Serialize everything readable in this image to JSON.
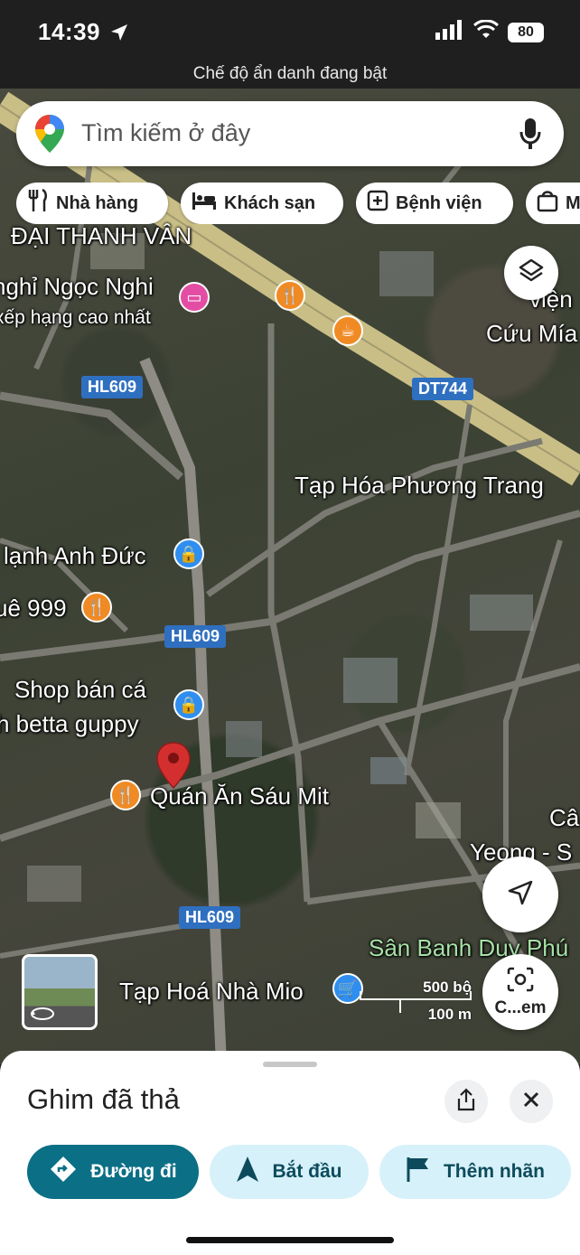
{
  "status_bar": {
    "time": "14:39",
    "battery": "80",
    "incognito_text": "Chế độ ẩn danh đang bật"
  },
  "search": {
    "placeholder": "Tìm kiếm ở đây"
  },
  "chips": [
    "Nhà hàng",
    "Khách sạn",
    "Bệnh viện",
    "M"
  ],
  "map": {
    "road_badges": [
      "HL609",
      "DT744",
      "HL609",
      "HL609"
    ],
    "labels": [
      "ĐẠI THANH VÂN",
      "nghỉ Ngọc Nghi",
      "xếp hạng cao nhất",
      "viện",
      "Cứu Mía",
      "Tạp Hóa Phương Trang",
      "lạnh Anh Đức",
      "uê 999",
      "Shop bán cá",
      "h betta guppy",
      "Quán Ăn Sáu Mit",
      "Câ",
      "Yeong - S",
      "Sân Banh Duy Phú",
      "Tạp Hoá Nhà Mio"
    ],
    "scale": {
      "imperial": "500 bộ",
      "metric": "100 m"
    },
    "lens_label": "C...em"
  },
  "sheet": {
    "title": "Ghim đã thả",
    "actions": {
      "directions": "Đường đi",
      "start": "Bắt đầu",
      "add_label": "Thêm nhãn"
    }
  },
  "colors": {
    "primary": "#0b6f86",
    "secondary_bg": "#d6f1f9",
    "pin": "#d32f2f",
    "road_badge": "#2f6fbf"
  }
}
